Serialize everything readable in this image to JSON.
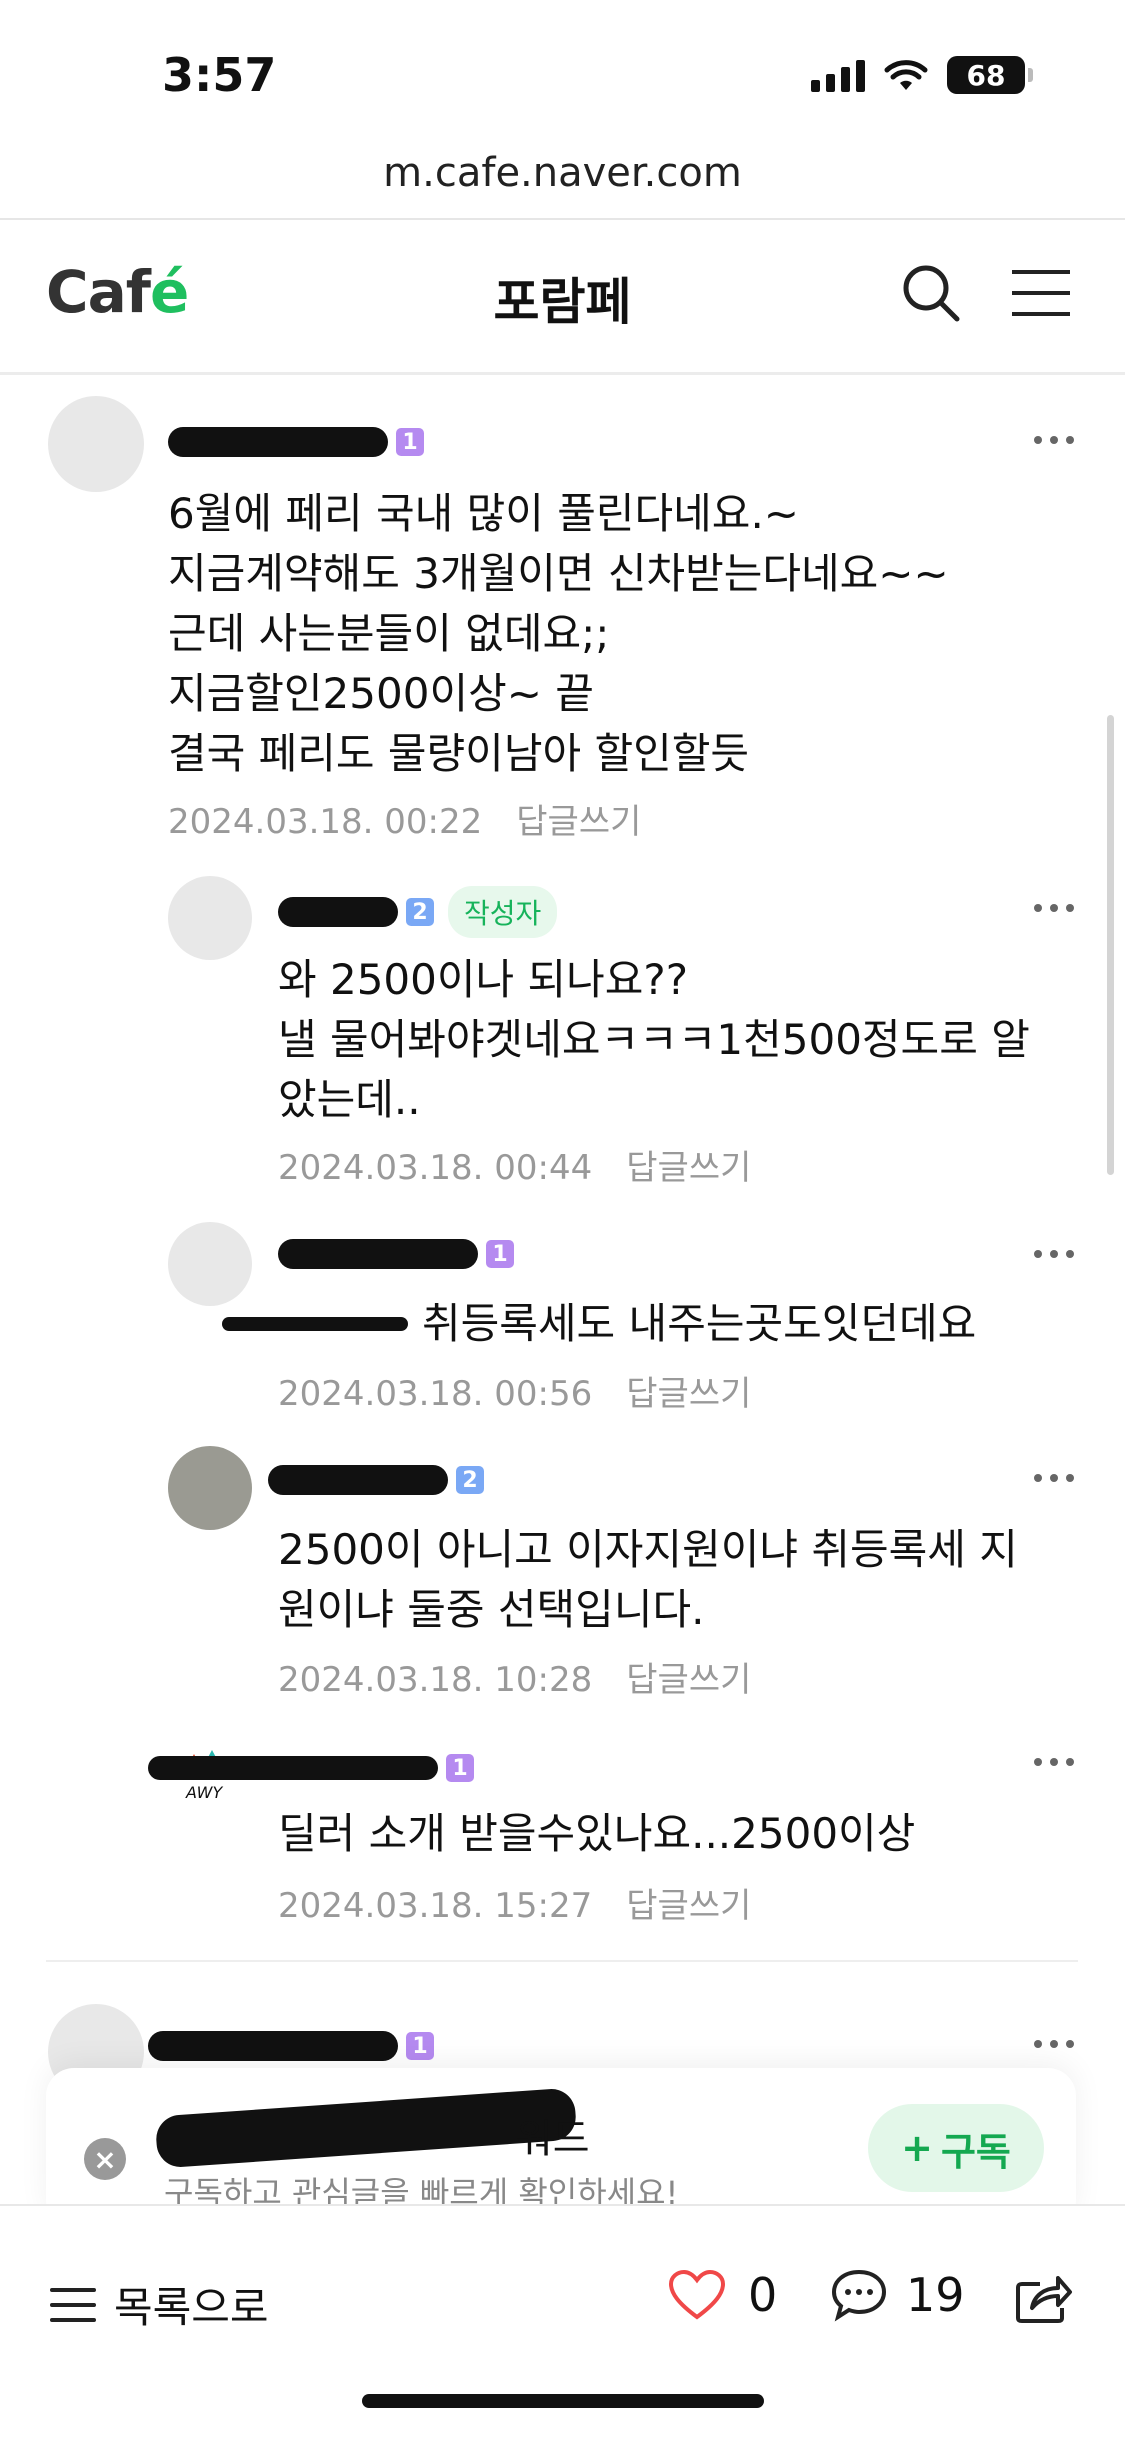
{
  "status_bar": {
    "time": "3:57",
    "battery": "68"
  },
  "browser": {
    "url": "m.cafe.naver.com"
  },
  "header": {
    "logo_prefix": "Caf",
    "logo_accent": "é",
    "title": "포람페"
  },
  "comments": [
    {
      "level": "1",
      "lines": [
        "6월에 페리 국내 많이 풀린다네요.~",
        "지금계약해도 3개월이면 신차받는다네요~~",
        "근데 사는분들이 없데요;;",
        "지금할인2500이상~ 끝",
        "결국 페리도 물량이남아 할인할듯"
      ],
      "date": "2024.03.18. 00:22",
      "reply_label": "답글쓰기"
    },
    {
      "level": "2",
      "writer_badge": "작성자",
      "lines": [
        "와 2500이나 되나요??",
        "낼 물어봐야겟네요ㅋㅋㅋ1천500정도로 알",
        "았는데.."
      ],
      "date": "2024.03.18. 00:44",
      "reply_label": "답글쓰기"
    },
    {
      "level": "1",
      "text": "취등록세도 내주는곳도잇던데요",
      "date": "2024.03.18. 00:56",
      "reply_label": "답글쓰기"
    },
    {
      "level": "2",
      "lines": [
        "2500이 아니고 이자지원이냐 취등록세 지",
        "원이냐 둘중 선택입니다."
      ],
      "date": "2024.03.18. 10:28",
      "reply_label": "답글쓰기"
    },
    {
      "level": "1",
      "text": "딜러 소개 받을수있나요...2500이상",
      "date": "2024.03.18. 15:27",
      "reply_label": "답글쓰기"
    },
    {
      "level": "1"
    }
  ],
  "banner": {
    "title_visible": "워드",
    "subtitle": "구독하고 관심글을 빠르게 확인하세요!",
    "subscribe_label": "구독"
  },
  "bottom_bar": {
    "list_label": "목록으로",
    "like_count": "0",
    "comment_count": "19"
  },
  "colors": {
    "accent_green": "#1fbf5f",
    "like_red": "#f04848",
    "level1": "#b58af0",
    "level2": "#7aa8f5"
  }
}
